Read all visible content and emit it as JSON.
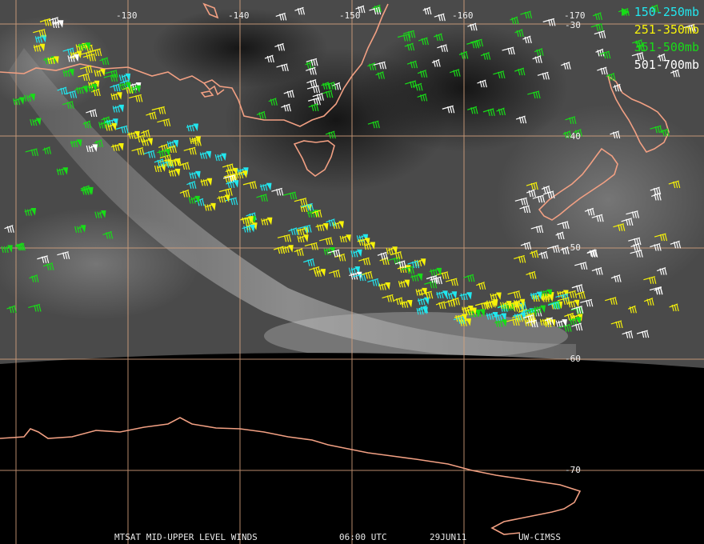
{
  "map": {
    "lon_labels": [
      "-130",
      "-140",
      "-150",
      "-160",
      "-170"
    ],
    "lat_labels": [
      "-30",
      "-40",
      "-50",
      "-60",
      "-70"
    ]
  },
  "legend": {
    "items": [
      {
        "label": "150-250mb",
        "color": "#22e6ee"
      },
      {
        "label": "251-350mb",
        "color": "#f6f20a"
      },
      {
        "label": "351-500mb",
        "color": "#18dc18"
      },
      {
        "label": "501-700mb",
        "color": "#ffffff"
      }
    ]
  },
  "footer": {
    "product": "MTSAT MID-UPPER LEVEL WINDS",
    "time": "06:00 UTC",
    "date": "29JUN11",
    "source": "UW-CIMSS"
  },
  "colors": {
    "coastline": "#f2a083",
    "gridline": "#d7a37e",
    "space": "#000000"
  }
}
